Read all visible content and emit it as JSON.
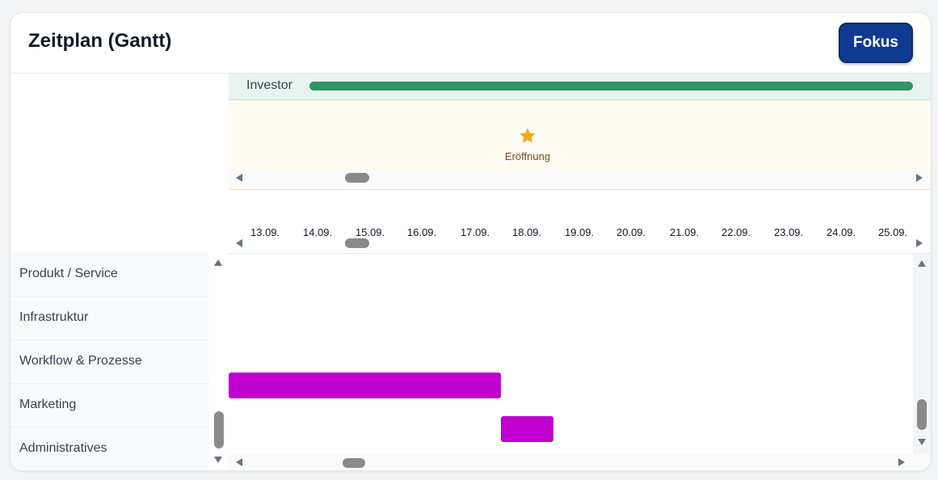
{
  "header": {
    "title": "Zeitplan (Gantt)",
    "focus_label": "Fokus"
  },
  "investor": {
    "label": "Investor",
    "bar_color": "#2f9467"
  },
  "milestones": [
    {
      "label": "Eröffnung",
      "icon": "star-icon",
      "color": "#f2a81d"
    }
  ],
  "dates": [
    "13.09.",
    "14.09.",
    "15.09.",
    "16.09.",
    "17.09.",
    "18.09.",
    "19.09.",
    "20.09.",
    "21.09.",
    "22.09.",
    "23.09.",
    "24.09.",
    "25.09."
  ],
  "categories": [
    {
      "label": "Produkt / Service"
    },
    {
      "label": "Infrastruktur"
    },
    {
      "label": "Workflow & Prozesse"
    },
    {
      "label": "Marketing"
    },
    {
      "label": "Administratives"
    }
  ],
  "tasks": [
    {
      "category": "Marketing",
      "start": "12.09.",
      "end": "17.09.",
      "color": "#bf00cf"
    },
    {
      "category": "Administratives",
      "start": "18.09.",
      "end": "18.09.",
      "color": "#bf00cf"
    }
  ],
  "colors": {
    "accent": "#0f3a91",
    "investor_band": "#e8f3ef",
    "milestone_band": "#fffbf0",
    "task": "#bf00cf"
  }
}
